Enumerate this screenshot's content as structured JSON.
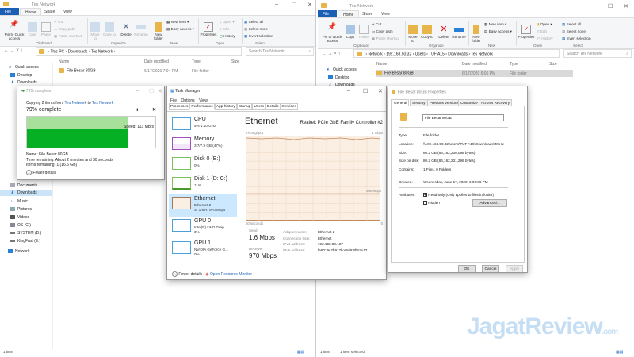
{
  "left_explorer": {
    "title": "Tes Network",
    "tabs": [
      "File",
      "Home",
      "Share",
      "View"
    ],
    "ribbon": {
      "clipboard": {
        "pin": "Pin to Quick access",
        "copy": "Copy",
        "paste": "Paste",
        "cut": "Cut",
        "copy_path": "Copy path",
        "paste_shortcut": "Paste shortcut",
        "label": "Clipboard"
      },
      "organize": {
        "move_to": "Move to",
        "copy_to": "Copy to",
        "delete": "Delete",
        "rename": "Rename",
        "label": "Organize"
      },
      "new": {
        "new_folder": "New folder",
        "new_item": "New item ▾",
        "easy_access": "Easy access ▾",
        "label": "New"
      },
      "open": {
        "properties": "Properties",
        "open": "Open ▾",
        "edit": "Edit",
        "history": "History",
        "label": "Open"
      },
      "select": {
        "select_all": "Select all",
        "select_none": "Select none",
        "invert": "Invert selection",
        "label": "Select"
      }
    },
    "breadcrumb": [
      "This PC",
      "Downloads",
      "Tes Network"
    ],
    "search_placeholder": "Search Tes Network",
    "columns": [
      "Name",
      "Date modified",
      "Type",
      "Size"
    ],
    "files": [
      {
        "name": "File Besar 80GB",
        "date": "6/17/2020 7:04 PM",
        "type": "File folder",
        "size": ""
      }
    ],
    "sidebar": [
      "Quick access",
      "Desktop",
      "Downloads",
      "Documents",
      "Downloads",
      "Music",
      "Pictures",
      "Videos",
      "OS (C:)",
      "SYSTEM (D:)",
      "KingFast (E:)",
      "Network"
    ],
    "status": "1 item"
  },
  "right_explorer": {
    "title": "Tes Network",
    "tabs": [
      "File",
      "Home",
      "Share",
      "View"
    ],
    "breadcrumb": [
      "Network",
      "192.168.50.32",
      "Users",
      "TUF A15",
      "Downloads",
      "Tes Network"
    ],
    "search_placeholder": "Search Tes Network",
    "columns": [
      "Name",
      "Date modified",
      "Type",
      "Size"
    ],
    "files": [
      {
        "name": "File Besar 80GB",
        "date": "6/17/2020 6:06 PM",
        "type": "File folder",
        "size": ""
      }
    ],
    "sidebar": [
      "Quick access",
      "Desktop",
      "Downloads"
    ],
    "status": "1 item",
    "status_selected": "1 item selected"
  },
  "copy_dialog": {
    "title": "79% complete",
    "copying_prefix": "Copying 2 items from ",
    "from": "Tes Network",
    "to_word": " to ",
    "to": "Tes Network",
    "heading": "79% complete",
    "progress_percent": 79,
    "speed": "Speed: 113 MB/s",
    "name": "Name: File Besar 80GB",
    "time_remaining": "Time remaining: About 2 minutes and 30 seconds",
    "items_remaining": "Items remaining: 1 (16.5 GB)",
    "fewer_details": "Fewer details",
    "accent": "#06b025"
  },
  "task_manager": {
    "title": "Task Manager",
    "menu": [
      "File",
      "Options",
      "View"
    ],
    "tabs": [
      "Processes",
      "Performance",
      "App history",
      "Startup",
      "Users",
      "Details",
      "Services"
    ],
    "items": [
      {
        "name": "CPU",
        "d1": "5% 1.10 GHz",
        "d2": ""
      },
      {
        "name": "Memory",
        "d1": "3.7/7.9 GB (47%)",
        "d2": ""
      },
      {
        "name": "Disk 0 (E:)",
        "d1": "0%",
        "d2": ""
      },
      {
        "name": "Disk 1 (D: C:)",
        "d1": "11%",
        "d2": ""
      },
      {
        "name": "Ethernet",
        "d1": "Ethernet 2",
        "d2": "S: 1.6 R: 970 Mbps"
      },
      {
        "name": "GPU 0",
        "d1": "Intel(R) UHD Grap...",
        "d2": "3%"
      },
      {
        "name": "GPU 1",
        "d1": "NVIDIA GeForce G...",
        "d2": "0%"
      }
    ],
    "heading": "Ethernet",
    "adapter_title": "Realtek PCIe GbE Family Controller #2",
    "graph_label": "Throughput",
    "graph_max": "1 Gbps",
    "graph_mid": "500 Mbps",
    "graph_time": "60 seconds",
    "graph_zero": "0",
    "send_label": "Send",
    "send_value": "1.6 Mbps",
    "receive_label": "Receive",
    "receive_value": "970 Mbps",
    "details": [
      {
        "k": "Adapter name:",
        "v": "Ethernet 2"
      },
      {
        "k": "Connection type:",
        "v": "Ethernet"
      },
      {
        "k": "IPv4 address:",
        "v": "192.168.50.187"
      },
      {
        "k": "IPv6 address:",
        "v": "fe80::9c2f:917b:e6d8:6f8c%17"
      }
    ],
    "fewer_details": "Fewer details",
    "resource_monitor": "Open Resource Monitor"
  },
  "properties": {
    "title": "File Besar 80GB Properties",
    "tabs": [
      "General",
      "Security",
      "Previous Versions",
      "Customize",
      "Acronis Recovery"
    ],
    "name": "File Besar 80GB",
    "rows1": [
      {
        "k": "Type:",
        "v": "File folder"
      },
      {
        "k": "Location:",
        "v": "\\\\192.168.50.32\\Users\\TUF A15\\Downloads\\Tes N"
      },
      {
        "k": "Size:",
        "v": "80.2 GB (86,162,230,098 bytes)"
      },
      {
        "k": "Size on disk:",
        "v": "80.2 GB (86,162,231,296 bytes)"
      },
      {
        "k": "Contains:",
        "v": "1 Files, 0 Folders"
      }
    ],
    "created_label": "Created:",
    "created": "Wednesday, June 17, 2020, 6:06:06 PM",
    "attributes_label": "Attributes:",
    "readonly": "Read-only (Only applies to files in folder)",
    "hidden": "Hidden",
    "advanced": "Advanced...",
    "ok": "OK",
    "cancel": "Cancel",
    "apply": "Apply"
  },
  "watermark": "JagatReview.com"
}
